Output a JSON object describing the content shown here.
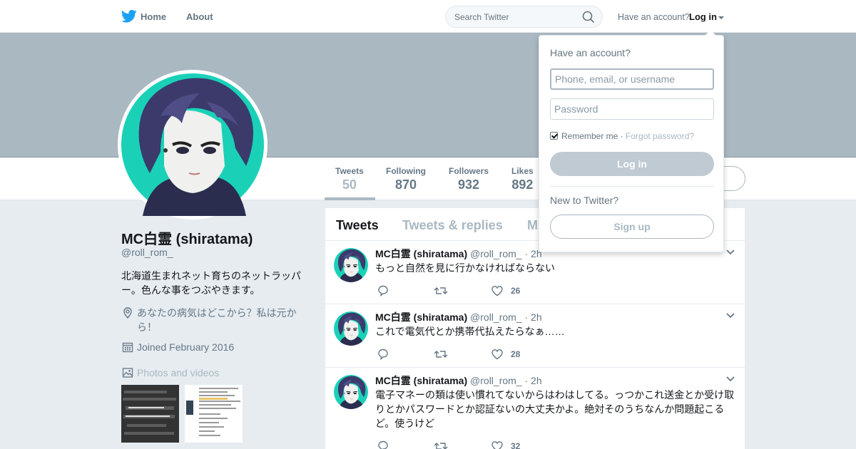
{
  "topbar": {
    "home_label": "Home",
    "about_label": "About",
    "search_placeholder": "Search Twitter",
    "have_account": "Have an account?",
    "login_label": "Log in"
  },
  "profile": {
    "display_name": "MC白霊 (shiratama)",
    "screen_name": "@roll_rom_",
    "bio": "北海道生まれネット育ちのネットラッパー。色んな事をつぶやきます。",
    "location": "あなたの病気はどこから？私は元から！",
    "joined": "Joined February 2016",
    "photos_label": "Photos and videos"
  },
  "stats": [
    {
      "label": "Tweets",
      "value": "50"
    },
    {
      "label": "Following",
      "value": "870"
    },
    {
      "label": "Followers",
      "value": "932"
    },
    {
      "label": "Likes",
      "value": "892"
    }
  ],
  "timeline": {
    "tabs": [
      "Tweets",
      "Tweets & replies",
      "M"
    ],
    "tweets": [
      {
        "name": "MC白霊 (shiratama)",
        "handle": "@roll_rom_",
        "time": "· 2h",
        "text": "もっと自然を見に行かなければならない",
        "likes": "26"
      },
      {
        "name": "MC白霊 (shiratama)",
        "handle": "@roll_rom_",
        "time": "· 2h",
        "text": "これで電気代とか携帯代払えたらなぁ……",
        "likes": "28"
      },
      {
        "name": "MC白霊 (shiratama)",
        "handle": "@roll_rom_",
        "time": "· 2h",
        "text": "電子マネーの類は使い慣れてないからはわはしてる。っつかこれ送金とか受け取りとかパスワードとか認証ないの大丈夫かよ。絶対そのうちなんか問題起こるど。使うけど",
        "likes": "32"
      }
    ]
  },
  "login_dropdown": {
    "title": "Have an account?",
    "username_placeholder": "Phone, email, or username",
    "password_placeholder": "Password",
    "remember_me": "Remember me",
    "separator": " · ",
    "forgot_password": "Forgot password?",
    "login_button": "Log in",
    "new_to_twitter": "New to Twitter?",
    "signup_button": "Sign up"
  },
  "colors": {
    "accent_gray": "#aab8c2",
    "avatar_bg": "#1ad1b8",
    "text_primary": "#14171a",
    "text_secondary": "#657786"
  },
  "icons": {
    "logo": "twitter-bird-icon",
    "search": "search-icon",
    "location": "location-pin-icon",
    "calendar": "calendar-icon",
    "photos": "image-icon",
    "reply": "reply-icon",
    "retweet": "retweet-icon",
    "like": "heart-icon",
    "more": "chevron-down-icon"
  }
}
